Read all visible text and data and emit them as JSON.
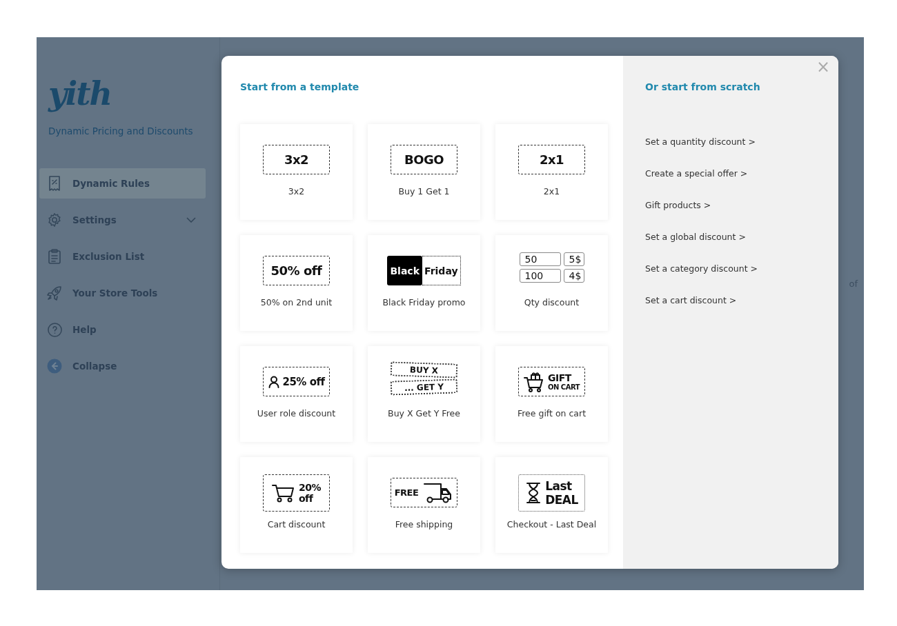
{
  "sidebar": {
    "logo": "yith",
    "subtitle": "Dynamic Pricing and Discounts",
    "items": [
      {
        "label": "Dynamic Rules",
        "kind": "rules",
        "selected": true
      },
      {
        "label": "Settings",
        "kind": "settings",
        "selected": false,
        "expanded": false
      },
      {
        "label": "Exclusion List",
        "kind": "exclusion",
        "selected": false
      },
      {
        "label": "Your Store Tools",
        "kind": "tools",
        "selected": false
      },
      {
        "label": "Help",
        "kind": "help",
        "selected": false
      },
      {
        "label": "Collapse",
        "kind": "collapse",
        "selected": false
      }
    ]
  },
  "background": {
    "field_suffix": "of"
  },
  "modal": {
    "templates_title": "Start from a template",
    "templates": [
      {
        "label": "3x2",
        "badge": {
          "kind": "plain",
          "lines": [
            "3x2"
          ]
        }
      },
      {
        "label": "Buy 1 Get 1",
        "badge": {
          "kind": "plain",
          "lines": [
            "BOGO"
          ]
        }
      },
      {
        "label": "2x1",
        "badge": {
          "kind": "plain",
          "lines": [
            "2x1"
          ]
        }
      },
      {
        "label": "50% on 2nd unit",
        "badge": {
          "kind": "plain",
          "lines": [
            "50% off"
          ]
        }
      },
      {
        "label": "Black Friday promo",
        "badge": {
          "kind": "split",
          "lines": [
            "Black",
            "Friday"
          ]
        }
      },
      {
        "label": "Qty discount",
        "badge": {
          "kind": "table",
          "rows": [
            [
              "50",
              "5$"
            ],
            [
              "100",
              "4$"
            ]
          ]
        }
      },
      {
        "label": "User role discount",
        "badge": {
          "kind": "user",
          "lines": [
            "25% off"
          ]
        }
      },
      {
        "label": "Buy X Get Y Free",
        "badge": {
          "kind": "tilted",
          "lines": [
            "BUY X",
            "... GET Y"
          ]
        }
      },
      {
        "label": "Free gift on cart",
        "badge": {
          "kind": "gift",
          "lines": [
            "GIFT",
            "ON CART"
          ]
        }
      },
      {
        "label": "Cart discount",
        "badge": {
          "kind": "cart",
          "lines": [
            "20%",
            "off"
          ]
        }
      },
      {
        "label": "Free shipping",
        "badge": {
          "kind": "shipping",
          "lines": [
            "FREE"
          ]
        }
      },
      {
        "label": "Checkout - Last Deal",
        "badge": {
          "kind": "deadline",
          "lines": [
            "Last",
            "DEAL"
          ]
        }
      }
    ],
    "scratch_title": "Or start from scratch",
    "scratch_links": [
      "Set a quantity discount >",
      "Create a special offer >",
      "Gift products >",
      "Set a global discount >",
      "Set a category discount >",
      "Set a cart discount >"
    ],
    "close": "×"
  }
}
